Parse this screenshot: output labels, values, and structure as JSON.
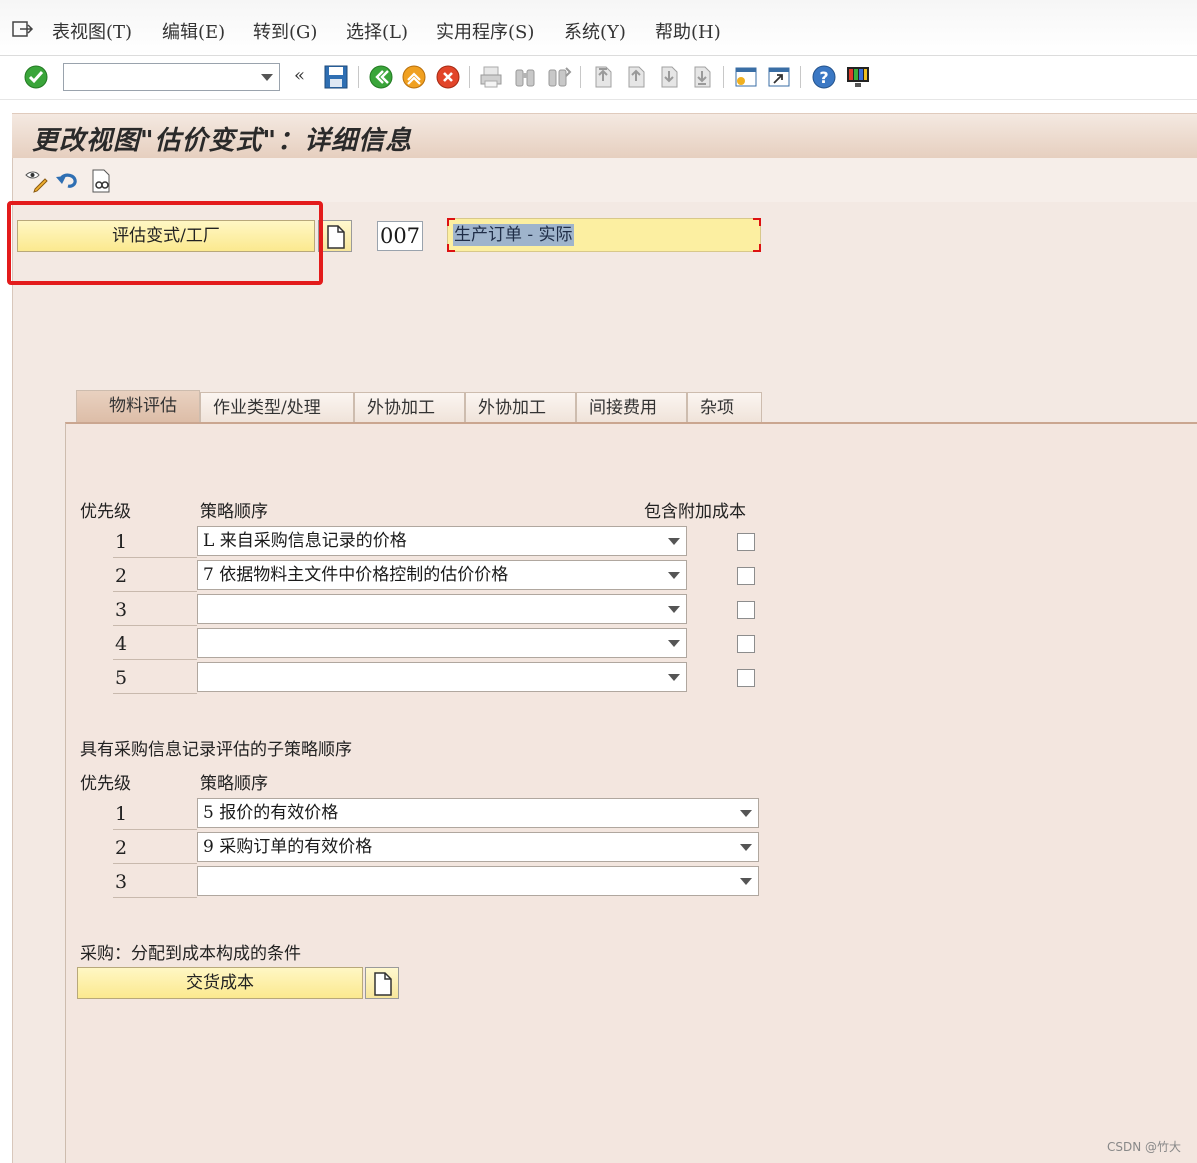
{
  "menu": {
    "items": [
      "表视图(T)",
      "编辑(E)",
      "转到(G)",
      "选择(L)",
      "实用程序(S)",
      "系统(Y)",
      "帮助(H)"
    ]
  },
  "toolbar": {
    "command_value": "",
    "icons": [
      "enter-icon",
      "back-arrows-icon",
      "save-icon",
      "back-icon",
      "exit-icon",
      "cancel-icon",
      "print-icon",
      "find-icon",
      "find-next-icon",
      "first-page-icon",
      "previous-page-icon",
      "next-page-icon",
      "last-page-icon",
      "create-session-icon",
      "shortcut-icon",
      "help-icon",
      "customize-layout-icon"
    ]
  },
  "page": {
    "title": "更改视图\"估价变式\"：详细信息"
  },
  "header": {
    "variant_button_label": "评估变式/工厂",
    "code": "007",
    "description": "生产订单 - 实际"
  },
  "tabs": [
    {
      "label": "物料评估",
      "active": true
    },
    {
      "label": "作业类型/处理",
      "active": false
    },
    {
      "label": "外协加工",
      "active": false
    },
    {
      "label": "外协加工",
      "active": false
    },
    {
      "label": "间接费用",
      "active": false
    },
    {
      "label": "杂项",
      "active": false
    }
  ],
  "strategy": {
    "col_priority": "优先级",
    "col_strategy": "策略顺序",
    "col_addcost": "包含附加成本",
    "rows": [
      {
        "num": "1",
        "value": "L 来自采购信息记录的价格",
        "checked": false
      },
      {
        "num": "2",
        "value": "7 依据物料主文件中价格控制的估价价格",
        "checked": false
      },
      {
        "num": "3",
        "value": "",
        "checked": false
      },
      {
        "num": "4",
        "value": "",
        "checked": false
      },
      {
        "num": "5",
        "value": "",
        "checked": false
      }
    ]
  },
  "sub_strategy": {
    "heading": "具有采购信息记录评估的子策略顺序",
    "col_priority": "优先级",
    "col_strategy": "策略顺序",
    "rows": [
      {
        "num": "1",
        "value": "5 报价的有效价格"
      },
      {
        "num": "2",
        "value": "9 采购订单的有效价格"
      },
      {
        "num": "3",
        "value": ""
      }
    ]
  },
  "purchasing": {
    "heading": "采购：分配到成本构成的条件",
    "button_label": "交货成本"
  },
  "watermark": "CSDN @竹大",
  "colors": {
    "title_bg": "#e6cfbf",
    "app_bg": "#f3e9e3",
    "button_yellow": "#fbe98f",
    "highlight_red": "#e31b1b"
  }
}
